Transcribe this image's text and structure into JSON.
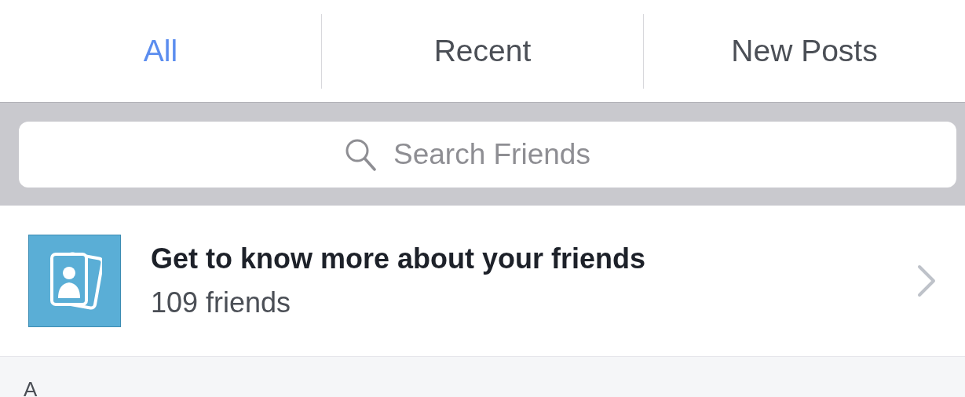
{
  "tabs": [
    {
      "label": "All",
      "selected": true
    },
    {
      "label": "Recent",
      "selected": false
    },
    {
      "label": "New Posts",
      "selected": false
    }
  ],
  "search": {
    "placeholder": "Search Friends"
  },
  "promo": {
    "title": "Get to know more about your friends",
    "subtitle": "109 friends"
  },
  "section_header": "A"
}
